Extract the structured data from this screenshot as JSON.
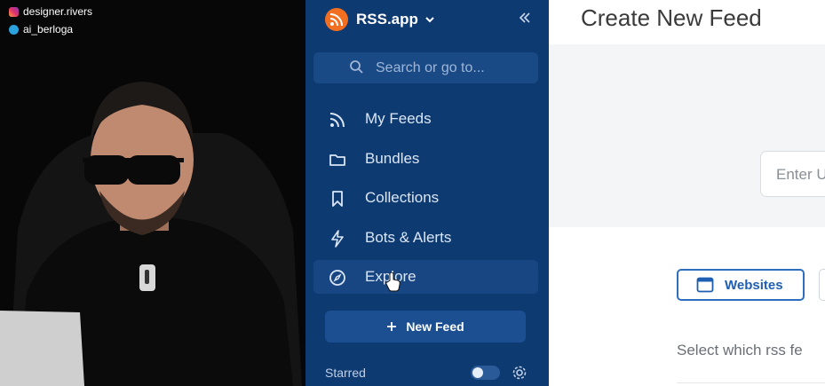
{
  "overlay": {
    "instagram": "designer.rivers",
    "telegram": "ai_berloga"
  },
  "sidebar": {
    "brand": "RSS.app",
    "search_placeholder": "Search or go to...",
    "items": [
      {
        "label": "My Feeds",
        "icon": "rss-icon"
      },
      {
        "label": "Bundles",
        "icon": "folder-icon"
      },
      {
        "label": "Collections",
        "icon": "bookmark-icon"
      },
      {
        "label": "Bots & Alerts",
        "icon": "lightning-icon"
      },
      {
        "label": "Explore",
        "icon": "compass-icon"
      }
    ],
    "new_feed_label": "New Feed",
    "starred_label": "Starred"
  },
  "main": {
    "title": "Create New Feed",
    "url_placeholder": "Enter U",
    "tab_websites": "Websites",
    "select_text": "Select which rss fe"
  },
  "colors": {
    "sidebar_bg": "#0e3a72",
    "accent": "#2f6dbf",
    "brand_orange": "#f26f22"
  }
}
